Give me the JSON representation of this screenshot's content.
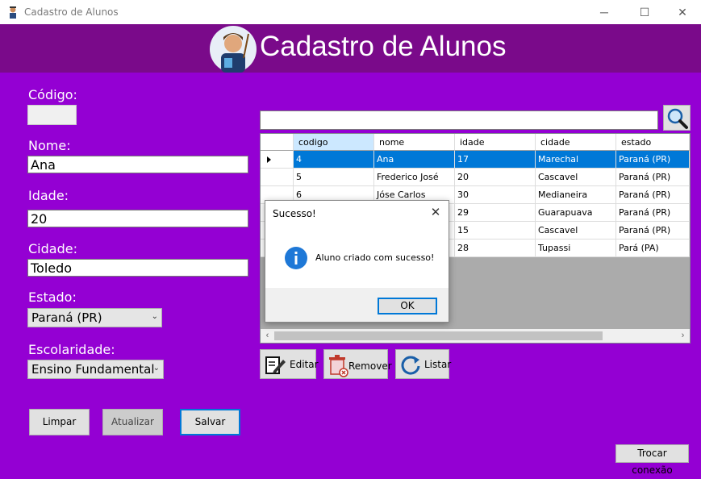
{
  "window": {
    "title": "Cadastro de Alunos",
    "minimize": "─",
    "maximize": "☐",
    "close": "✕"
  },
  "header": {
    "title": "Cadastro de Alunos"
  },
  "form": {
    "codigo_label": "Código:",
    "codigo_value": "",
    "nome_label": "Nome:",
    "nome_value": "Ana",
    "idade_label": "Idade:",
    "idade_value": "20",
    "cidade_label": "Cidade:",
    "cidade_value": "Toledo",
    "estado_label": "Estado:",
    "estado_value": "Paraná (PR)",
    "escolaridade_label": "Escolaridade:",
    "escolaridade_value": "Ensino Fundamental"
  },
  "buttons": {
    "limpar": "Limpar",
    "atualizar": "Atualizar",
    "salvar": "Salvar",
    "trocar": "Trocar conexão"
  },
  "search": {
    "value": ""
  },
  "grid": {
    "columns": [
      "codigo",
      "nome",
      "idade",
      "cidade",
      "estado"
    ],
    "rows": [
      [
        "4",
        "Ana",
        "17",
        "Marechal",
        "Paraná (PR)"
      ],
      [
        "5",
        "Frederico José",
        "20",
        "Cascavel",
        "Paraná (PR)"
      ],
      [
        "6",
        "Jóse Carlos",
        "30",
        "Medianeira",
        "Paraná (PR)"
      ],
      [
        "",
        "",
        "29",
        "Guarapuava",
        "Paraná (PR)"
      ],
      [
        "",
        "",
        "15",
        "Cascavel",
        "Paraná (PR)"
      ],
      [
        "",
        "",
        "28",
        "Tupassi",
        "Pará (PA)"
      ]
    ],
    "selected_row": 0
  },
  "actions": {
    "editar": "Editar",
    "remover": "Remover",
    "listar": "Listar"
  },
  "dialog": {
    "title": "Sucesso!",
    "message": "Aluno criado com sucesso!",
    "ok": "OK"
  },
  "colors": {
    "background": "#9400d3",
    "header": "#7a0a8a",
    "selection": "#0078d7"
  }
}
